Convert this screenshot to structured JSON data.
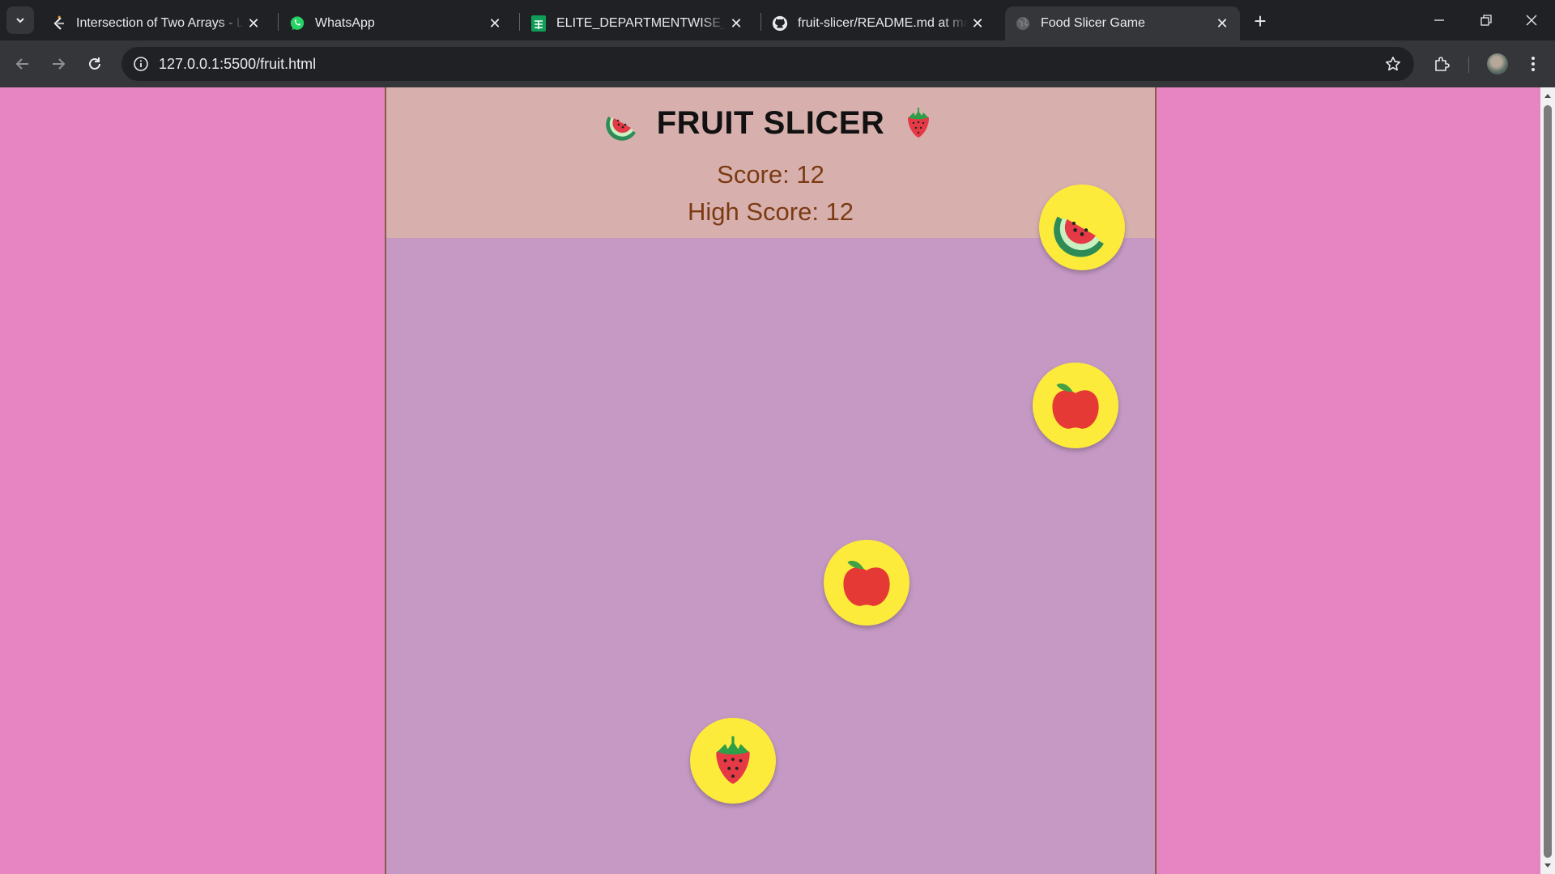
{
  "browser": {
    "tabs": [
      {
        "title": "Intersection of Two Arrays - LeetCode",
        "icon": "leetcode-icon"
      },
      {
        "title": "WhatsApp",
        "icon": "whatsapp-icon"
      },
      {
        "title": "ELITE_DEPARTMENTWISE_GITHUB",
        "icon": "sheets-icon"
      },
      {
        "title": "fruit-slicer/README.md at main",
        "icon": "github-icon"
      },
      {
        "title": "Food Slicer Game",
        "icon": "globe-icon",
        "active": true
      }
    ],
    "url": "127.0.0.1:5500/fruit.html"
  },
  "game": {
    "title": "FRUIT SLICER",
    "score_text": "Score: 12",
    "high_score_text": "High Score: 12",
    "fruits": [
      "watermelon",
      "apple",
      "apple",
      "strawberry"
    ]
  },
  "colors": {
    "page_background": "#e685c2",
    "game_area": "#c599c4",
    "header_background": "#d7b0ae",
    "score_text": "#7b3a12",
    "fruit_circle": "#fdeb3b"
  }
}
